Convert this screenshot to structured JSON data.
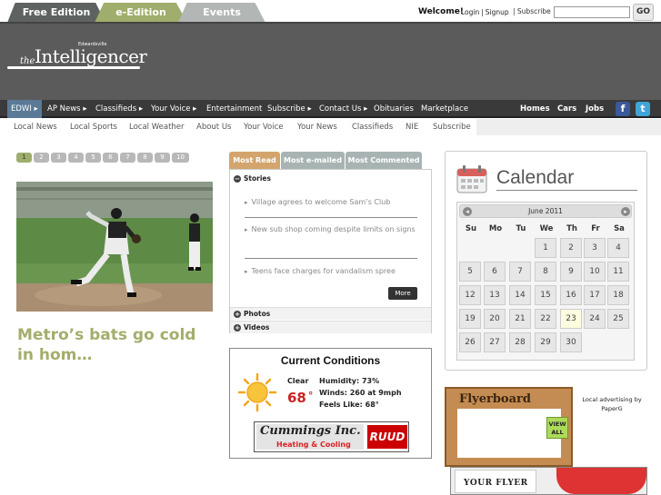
{
  "topbar": {
    "tabs": [
      "Free Edition",
      "e-Edition",
      "Events"
    ],
    "welcome": "Welcome!",
    "login": "Login",
    "signup": "Signup",
    "subscribe": "Subscribe",
    "search_value": "",
    "go_label": "GO"
  },
  "header": {
    "logo_the": "the",
    "logo_name": "Intelligencer",
    "logo_small": "Edwardsville"
  },
  "mainnav": {
    "items": [
      "EDWI ▸",
      "AP News ▸",
      "Classifieds ▸",
      "Your Voice ▸",
      "Entertainment",
      "Subscribe ▸",
      "Contact Us ▸",
      "Obituaries",
      "Marketplace"
    ],
    "right": [
      "Homes",
      "Cars",
      "Jobs"
    ],
    "facebook": "f",
    "twitter": "t"
  },
  "subnav": {
    "items": [
      "Local News",
      "Local Sports",
      "Local Weather",
      "About Us",
      "Your Voice",
      "Your News",
      "Classifieds",
      "NIE",
      "Subscribe"
    ]
  },
  "slideshow": {
    "pages": [
      "1",
      "2",
      "3",
      "4",
      "5",
      "6",
      "7",
      "8",
      "9",
      "10"
    ],
    "headline": "Metro’s bats go cold in hom…"
  },
  "tabs": {
    "labels": [
      "Most Read",
      "Most e-mailed",
      "Most Commented"
    ],
    "stories_header": "Stories",
    "stories": [
      "Village agrees to welcome Sam’s Club",
      "New sub shop coming despite limits on signs",
      "Teens face charges for vandalism spree"
    ],
    "more": "More",
    "photos": "Photos",
    "videos": "Videos"
  },
  "weather": {
    "title": "Current Conditions",
    "condition": "Clear",
    "temp": "68",
    "degree": "°",
    "humidity": "Humidity: 73%",
    "winds": "Winds: 260 at 9mph",
    "feels": "Feels Like: 68°",
    "ad_name": "Cummings Inc.",
    "ad_tag": "Heating & Cooling",
    "ad_brand": "RUUD"
  },
  "calendar": {
    "title": "Calendar",
    "month": "June 2011",
    "dows": [
      "Su",
      "Mo",
      "Tu",
      "We",
      "Th",
      "Fr",
      "Sa"
    ],
    "today": "23",
    "days": [
      "1",
      "2",
      "3",
      "4",
      "5",
      "6",
      "7",
      "8",
      "9",
      "10",
      "11",
      "12",
      "13",
      "14",
      "15",
      "16",
      "17",
      "18",
      "19",
      "20",
      "21",
      "22",
      "23",
      "24",
      "25",
      "26",
      "27",
      "28",
      "29",
      "30"
    ]
  },
  "flyer": {
    "title": "Flyerboard",
    "view_all": "VIEW ALL",
    "ad_text": "Local advertising by PaperG",
    "your_flyer": "YOUR FLYER"
  },
  "colors": {
    "accent_green": "#9fae6c",
    "nav_dark": "#3a3a3a",
    "header_grey": "#5b5b5b",
    "tab_tan": "#d3a56d",
    "temp_red": "#cc2222"
  }
}
